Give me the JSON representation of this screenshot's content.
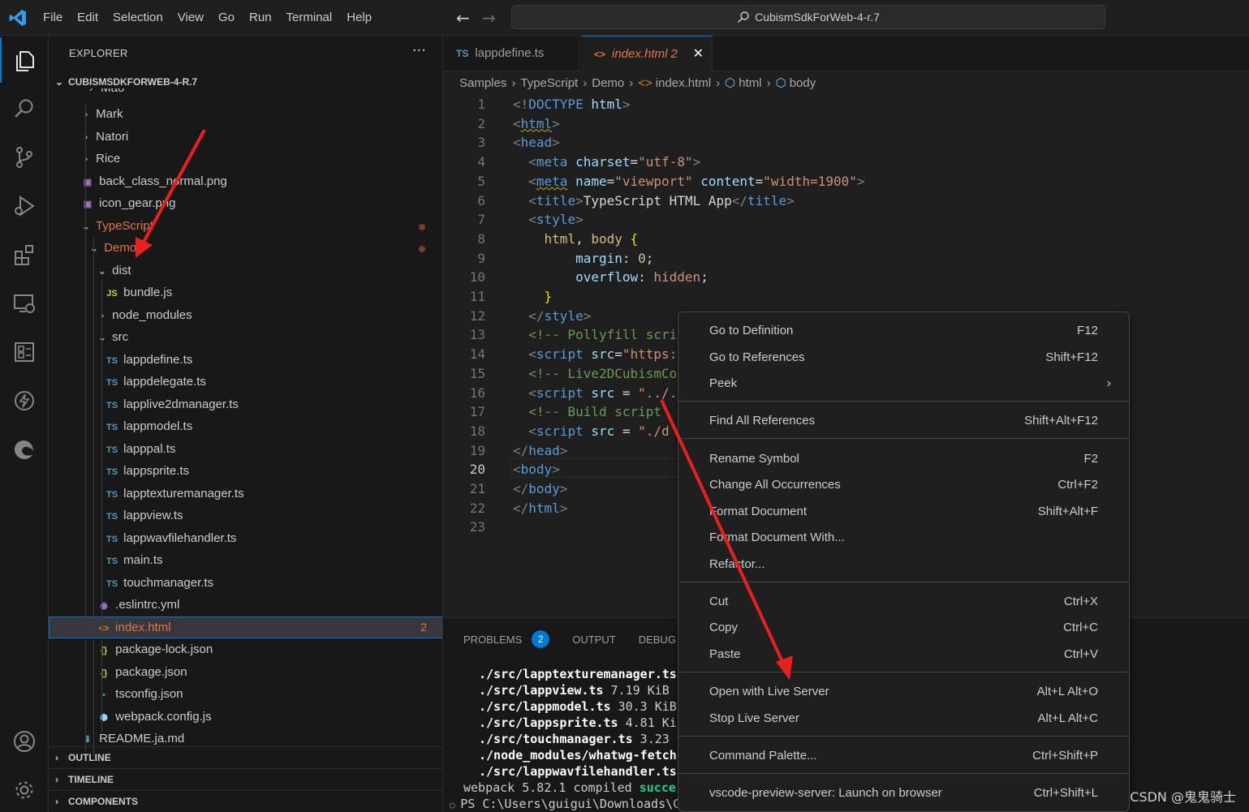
{
  "titlebar": {
    "menu": [
      "File",
      "Edit",
      "Selection",
      "View",
      "Go",
      "Run",
      "Terminal",
      "Help"
    ],
    "search_text": "CubismSdkForWeb-4-r.7"
  },
  "activitybar": {
    "icons": [
      "explorer-icon",
      "search-icon",
      "source-control-icon",
      "run-debug-icon",
      "extensions-icon",
      "remote-explorer-icon",
      "cmake-icon",
      "live-share-icon",
      "edge-icon",
      "account-icon",
      "settings-gear-icon"
    ]
  },
  "sidebar": {
    "title": "EXPLORER",
    "more": "···",
    "root": "CUBISMSDKFORWEB-4-R.7",
    "partial_top": "Mao",
    "tree": [
      {
        "label": "Mark",
        "type": "folder",
        "open": false,
        "icon": ""
      },
      {
        "label": "Natori",
        "type": "folder",
        "open": false,
        "icon": ""
      },
      {
        "label": "Rice",
        "type": "folder",
        "open": false,
        "icon": ""
      },
      {
        "label": "back_class_normal.png",
        "type": "file",
        "icon": "png"
      },
      {
        "label": "icon_gear.png",
        "type": "file",
        "icon": "png"
      },
      {
        "label": "TypeScript",
        "type": "folder",
        "open": true,
        "icon": "",
        "modified": true
      },
      {
        "label": "Demo",
        "type": "folder",
        "open": true,
        "icon": "",
        "modified": true
      },
      {
        "label": "dist",
        "type": "folder",
        "open": true,
        "icon": ""
      },
      {
        "label": "bundle.js",
        "type": "file",
        "icon": "JS"
      },
      {
        "label": "node_modules",
        "type": "folder",
        "open": false,
        "icon": ""
      },
      {
        "label": "src",
        "type": "folder",
        "open": true,
        "icon": ""
      },
      {
        "label": "lappdefine.ts",
        "type": "file",
        "icon": "TS"
      },
      {
        "label": "lappdelegate.ts",
        "type": "file",
        "icon": "TS"
      },
      {
        "label": "lapplive2dmanager.ts",
        "type": "file",
        "icon": "TS"
      },
      {
        "label": "lappmodel.ts",
        "type": "file",
        "icon": "TS"
      },
      {
        "label": "lapppal.ts",
        "type": "file",
        "icon": "TS"
      },
      {
        "label": "lappsprite.ts",
        "type": "file",
        "icon": "TS"
      },
      {
        "label": "lapptexturemanager.ts",
        "type": "file",
        "icon": "TS"
      },
      {
        "label": "lappview.ts",
        "type": "file",
        "icon": "TS"
      },
      {
        "label": "lappwavfilehandler.ts",
        "type": "file",
        "icon": "TS"
      },
      {
        "label": "main.ts",
        "type": "file",
        "icon": "TS"
      },
      {
        "label": "touchmanager.ts",
        "type": "file",
        "icon": "TS"
      },
      {
        "label": ".eslintrc.yml",
        "type": "file",
        "icon": "yml"
      },
      {
        "label": "index.html",
        "type": "file",
        "icon": "<>",
        "badge": "2",
        "selected": true
      },
      {
        "label": "package-lock.json",
        "type": "file",
        "icon": "{}"
      },
      {
        "label": "package.json",
        "type": "file",
        "icon": "{}"
      },
      {
        "label": "tsconfig.json",
        "type": "file",
        "icon": "ts"
      },
      {
        "label": "webpack.config.js",
        "type": "file",
        "icon": "webpack"
      },
      {
        "label": "README.ja.md",
        "type": "file",
        "icon": "md"
      }
    ],
    "sections": [
      "OUTLINE",
      "TIMELINE",
      "COMPONENTS"
    ]
  },
  "editor": {
    "tabs": [
      {
        "label": "lappdefine.ts",
        "icon": "TS",
        "active": false
      },
      {
        "label": "index.html 2",
        "icon": "<>",
        "active": true,
        "close": "✕"
      }
    ],
    "breadcrumb": [
      "Samples",
      "TypeScript",
      "Demo",
      "index.html",
      "html",
      "body"
    ],
    "current_line": "20"
  },
  "panel": {
    "tabs": [
      "PROBLEMS",
      "OUTPUT",
      "DEBUG C"
    ],
    "problems_count": "2",
    "terminal": [
      {
        "path": "./src/lapptexturemanager.ts",
        "rest": ""
      },
      {
        "path": "./src/lappview.ts",
        "rest": " 7.19 KiB"
      },
      {
        "path": "./src/lappmodel.ts",
        "rest": " 30.3 KiB"
      },
      {
        "path": "./src/lappsprite.ts",
        "rest": " 4.81 Ki"
      },
      {
        "path": "./src/touchmanager.ts",
        "rest": " 3.23"
      },
      {
        "path": "./node_modules/whatwg-fetch/",
        "rest": ""
      },
      {
        "path": "./src/lappwavfilehandler.ts",
        "rest": ""
      }
    ],
    "compiled": "webpack 5.82.1 compiled ",
    "compiled_status": "succe",
    "prompt": "PS C:\\Users\\guigui\\Downloads\\C"
  },
  "context_menu": {
    "items": [
      {
        "label": "Go to Definition",
        "key": "F12"
      },
      {
        "label": "Go to References",
        "key": "Shift+F12"
      },
      {
        "label": "Peek",
        "key": "",
        "submenu": "›"
      },
      {
        "label": "Find All References",
        "key": "Shift+Alt+F12"
      },
      {
        "label": "Rename Symbol",
        "key": "F2"
      },
      {
        "label": "Change All Occurrences",
        "key": "Ctrl+F2"
      },
      {
        "label": "Format Document",
        "key": "Shift+Alt+F"
      },
      {
        "label": "Format Document With...",
        "key": ""
      },
      {
        "label": "Refactor...",
        "key": ""
      },
      {
        "label": "Cut",
        "key": "Ctrl+X"
      },
      {
        "label": "Copy",
        "key": "Ctrl+C"
      },
      {
        "label": "Paste",
        "key": "Ctrl+V"
      },
      {
        "label": "Open with Live Server",
        "key": "Alt+L Alt+O"
      },
      {
        "label": "Stop Live Server",
        "key": "Alt+L Alt+C"
      },
      {
        "label": "Command Palette...",
        "key": "Ctrl+Shift+P"
      },
      {
        "label": "vscode-preview-server: Launch on browser",
        "key": "Ctrl+Shift+L"
      }
    ]
  },
  "watermark": "CSDN @鬼鬼骑士",
  "colors": {
    "accent": "#0078d4",
    "annotation": "#e8201e",
    "modified": "#e2744c"
  }
}
